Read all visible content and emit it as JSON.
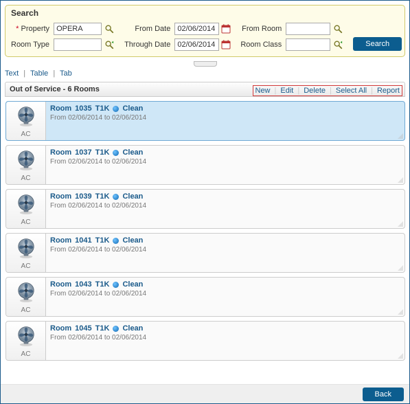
{
  "search": {
    "title": "Search",
    "property_label": "Property",
    "property_value": "OPERA",
    "room_type_label": "Room Type",
    "room_type_value": "",
    "from_date_label": "From Date",
    "from_date_value": "02/06/2014",
    "through_date_label": "Through Date",
    "through_date_value": "02/06/2014",
    "from_room_label": "From Room",
    "from_room_value": "",
    "room_class_label": "Room Class",
    "room_class_value": "",
    "button_label": "Search"
  },
  "tabs": {
    "text": "Text",
    "table": "Table",
    "tab": "Tab"
  },
  "results": {
    "title": "Out of Service - 6 Rooms",
    "actions": {
      "new": "New",
      "edit": "Edit",
      "delete": "Delete",
      "select_all": "Select All",
      "report": "Report"
    },
    "items": [
      {
        "thumb_label": "AC",
        "room_prefix": "Room",
        "room_number": "1035",
        "room_type": "T1K",
        "status": "Clean",
        "dates": "From 02/06/2014 to 02/06/2014",
        "selected": true
      },
      {
        "thumb_label": "AC",
        "room_prefix": "Room",
        "room_number": "1037",
        "room_type": "T1K",
        "status": "Clean",
        "dates": "From 02/06/2014 to 02/06/2014",
        "selected": false
      },
      {
        "thumb_label": "AC",
        "room_prefix": "Room",
        "room_number": "1039",
        "room_type": "T1K",
        "status": "Clean",
        "dates": "From 02/06/2014 to 02/06/2014",
        "selected": false
      },
      {
        "thumb_label": "AC",
        "room_prefix": "Room",
        "room_number": "1041",
        "room_type": "T1K",
        "status": "Clean",
        "dates": "From 02/06/2014 to 02/06/2014",
        "selected": false
      },
      {
        "thumb_label": "AC",
        "room_prefix": "Room",
        "room_number": "1043",
        "room_type": "T1K",
        "status": "Clean",
        "dates": "From 02/06/2014 to 02/06/2014",
        "selected": false
      },
      {
        "thumb_label": "AC",
        "room_prefix": "Room",
        "room_number": "1045",
        "room_type": "T1K",
        "status": "Clean",
        "dates": "From 02/06/2014 to 02/06/2014",
        "selected": false
      }
    ]
  },
  "footer": {
    "back": "Back"
  }
}
